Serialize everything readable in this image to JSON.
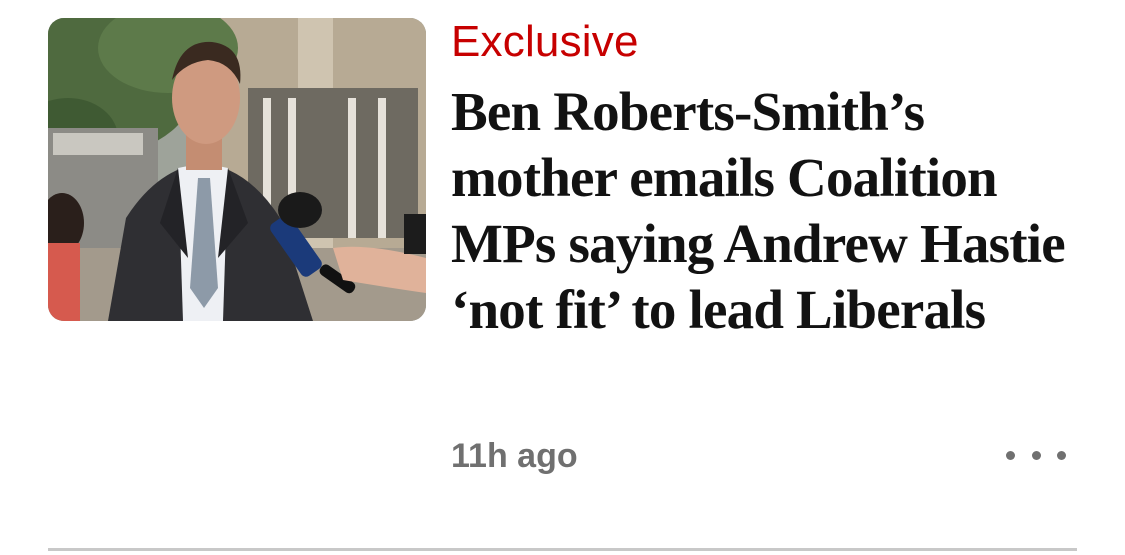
{
  "article": {
    "kicker": "Exclusive",
    "headline": "Ben Roberts-Smith’s mother emails Coalition MPs saying Andrew Hastie ‘not fit’ to lead Liberals",
    "timestamp": "11h ago",
    "more_icon": "ellipsis-icon",
    "image_alt": "Ben Roberts-Smith outside court speaking to reporters"
  },
  "colors": {
    "kicker": "#c70000",
    "headline": "#121212",
    "meta": "#707070",
    "divider": "#c8c8c8"
  }
}
